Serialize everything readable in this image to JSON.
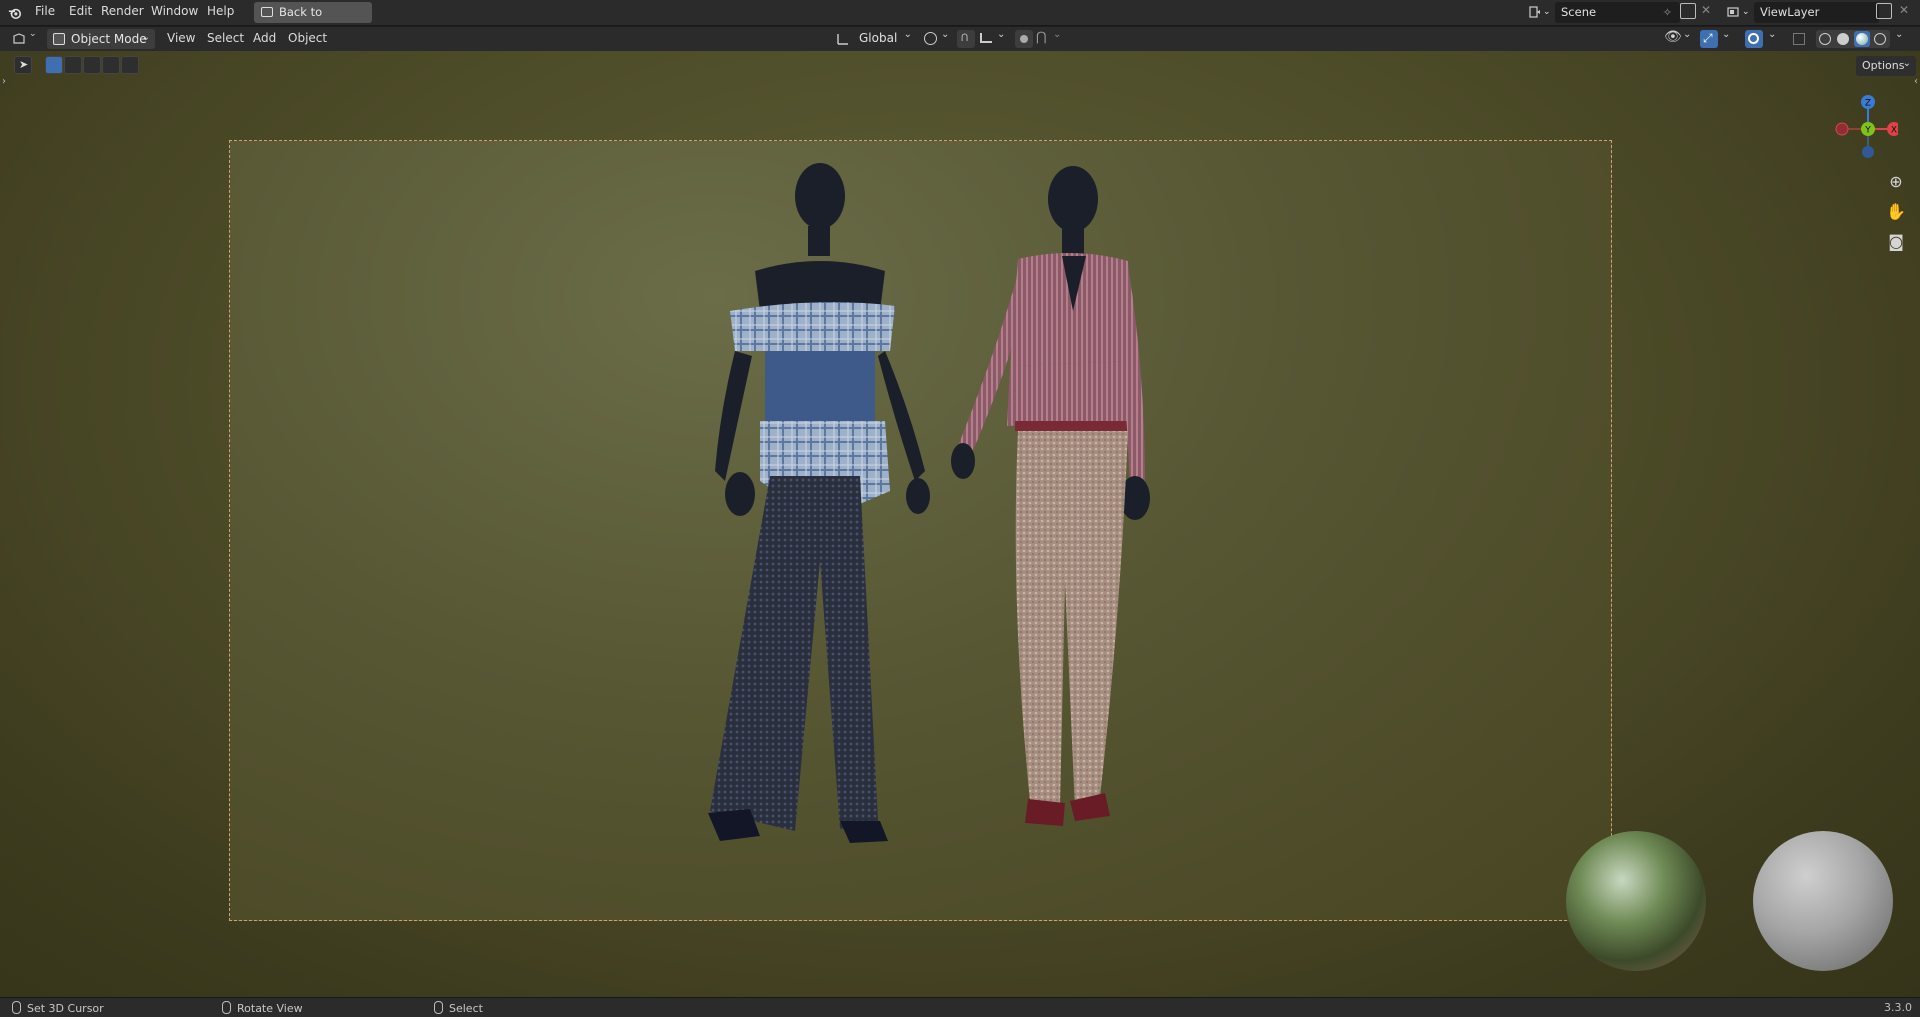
{
  "topbar": {
    "menus": [
      "File",
      "Edit",
      "Render",
      "Window",
      "Help"
    ],
    "back_button": "Back to Previous",
    "scene": "Scene",
    "view_layer": "ViewLayer"
  },
  "header": {
    "mode": "Object Mode",
    "menus": [
      "View",
      "Select",
      "Add",
      "Object"
    ],
    "transform_orientation": "Global"
  },
  "viewport": {
    "options_label": "Options",
    "gizmo": {
      "x": "X",
      "y": "Y",
      "z": "Z"
    }
  },
  "statusbar": {
    "left_click": "Set 3D Cursor",
    "middle_click": "Rotate View",
    "right_click": "Select",
    "version": "3.3.0"
  },
  "colors": {
    "x_axis": "#e0414a",
    "y_axis": "#7ec31b",
    "z_axis": "#3a7bd5",
    "frame_border": "#d8a070"
  }
}
